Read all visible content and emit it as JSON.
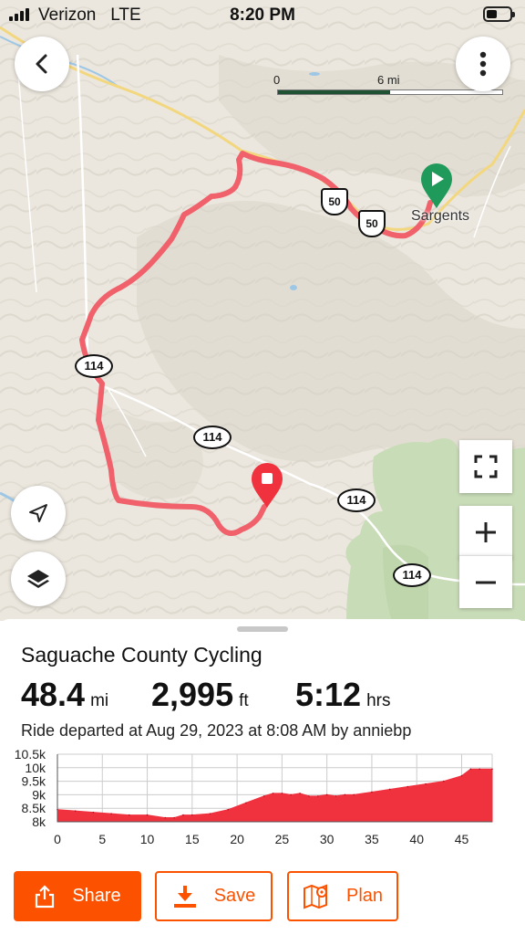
{
  "status_bar": {
    "carrier": "Verizon",
    "network": "LTE",
    "time": "8:20 PM"
  },
  "map": {
    "scale": {
      "start": "0",
      "mid": "6 mi",
      "end": "mi"
    },
    "place_label": "Sargents",
    "shields": {
      "us50_a": "50",
      "us50_b": "50",
      "co114_a": "114",
      "co114_b": "114",
      "co114_c": "114",
      "co114_d": "114"
    },
    "route_color": "#f0616b",
    "start_marker_color": "#1f9a5a",
    "end_marker_color": "#f0313e",
    "icons": {
      "back": "chevron-left-icon",
      "more": "more-vertical-icon",
      "locate": "navigation-arrow-icon",
      "layers": "layers-icon",
      "fullscreen": "fullscreen-icon",
      "zoom_in": "plus-icon",
      "zoom_out": "minus-icon"
    }
  },
  "activity": {
    "title": "Saguache County Cycling",
    "distance": {
      "value": "48.4",
      "unit": "mi"
    },
    "elevation": {
      "value": "2,995",
      "unit": "ft"
    },
    "time": {
      "value": "5:12",
      "unit": "hrs"
    },
    "departed_text": "Ride departed at Aug 29, 2023 at 8:08 AM by anniebp"
  },
  "chart_data": {
    "type": "area",
    "title": "",
    "xlabel": "",
    "ylabel": "",
    "x_ticks": [
      "0",
      "5",
      "10",
      "15",
      "20",
      "25",
      "30",
      "35",
      "40",
      "45"
    ],
    "y_ticks": [
      "10.5k",
      "10k",
      "9.5k",
      "9k",
      "8.5k",
      "8k"
    ],
    "xlim": [
      0,
      48.4
    ],
    "ylim": [
      8000,
      10500
    ],
    "grid": true,
    "fill_color": "#f0313e",
    "series": [
      {
        "x": [
          0,
          2,
          4,
          6,
          8,
          10,
          12,
          13,
          14,
          15,
          17,
          19,
          21,
          23,
          24,
          25,
          26,
          27,
          28,
          29,
          30,
          31,
          32,
          33,
          35,
          37,
          39,
          41,
          43,
          45,
          46,
          47,
          48.4
        ],
        "y": [
          8450,
          8400,
          8350,
          8300,
          8250,
          8250,
          8150,
          8150,
          8250,
          8250,
          8300,
          8450,
          8700,
          8950,
          9050,
          9050,
          9000,
          9050,
          8950,
          8950,
          9000,
          8950,
          9000,
          9000,
          9100,
          9200,
          9300,
          9400,
          9500,
          9700,
          9950,
          9950,
          9950
        ]
      }
    ]
  },
  "actions": {
    "share": "Share",
    "save": "Save",
    "plan": "Plan",
    "brand_color": "#fc5200"
  }
}
